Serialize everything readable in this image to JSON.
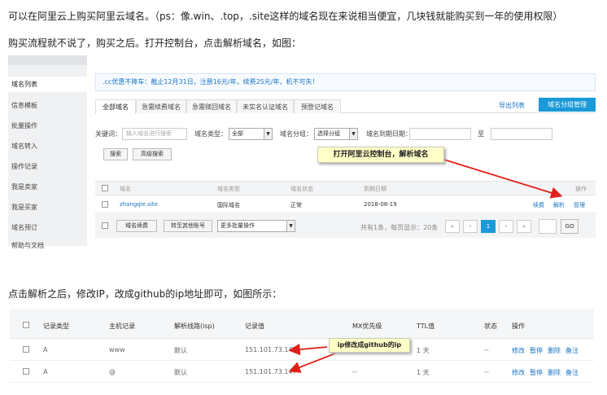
{
  "paragraphs": {
    "intro": "可以在阿里云上购买阿里云域名。（ps：像.win、.top，.site这样的域名现在来说相当便宜，几块钱就能购买到一年的使用权限）",
    "buy": "购买流程就不说了，购买之后。打开控制台，点击解析域名，如图：",
    "after": "点击解析之后，修改IP，改成github的ip地址即可，如图所示："
  },
  "console": {
    "sidebar_items": [
      "域名列表",
      "信息模板",
      "批量操作",
      "域名转入",
      "操作记录",
      "我是卖家",
      "我是买家",
      "域名预订",
      "帮助与文档"
    ],
    "notice": ".cc优惠不降车：截止12月31日，注册16元/年，续费25元/年，机不可失！",
    "tabs": [
      "全部域名",
      "急需续费域名",
      "急需赎回域名",
      "未实名认证域名",
      "预登记域名"
    ],
    "export_label": "导出列表",
    "group_manage_label": "域名分组管理",
    "filters": {
      "keyword_label": "关键词：",
      "keyword_placeholder": "输入域名进行搜索",
      "type_label": "域名类型：",
      "type_value": "全部",
      "group_label": "域名分组：",
      "group_value": "选择分组",
      "expiry_label": "域名到期日期：",
      "to_label": "至",
      "search_button": "搜索",
      "advanced_button": "高级搜索"
    },
    "table_headers": [
      "域名",
      "域名类型",
      "域名状态",
      "到期日期",
      "操作"
    ],
    "row": {
      "domain": "zhangqie.site",
      "type": "国际域名",
      "status": "正常",
      "expiry": "2018-08-19",
      "actions": [
        "续费",
        "解析",
        "管理"
      ]
    },
    "footer": {
      "renew_button": "域名续费",
      "transfer_button": "转至其他账号",
      "batch_value": "更多批量操作",
      "page_info": "共有1条，每页显示：20条",
      "pages": [
        "«",
        "‹",
        "1",
        "›",
        "»"
      ],
      "go_button": "GO"
    },
    "callout": "打开阿里云控制台，解析域名"
  },
  "dns": {
    "headers": [
      "记录类型",
      "主机记录",
      "解析线路(isp)",
      "记录值",
      "MX优先级",
      "TTL值",
      "状态",
      "操作"
    ],
    "rows": [
      {
        "type": "A",
        "host": "www",
        "line": "默认",
        "value": "151.101.73.147",
        "mx": "",
        "ttl": "1 天",
        "status": "--",
        "actions": [
          "修改",
          "暂停",
          "删除",
          "备注"
        ]
      },
      {
        "type": "A",
        "host": "@",
        "line": "默认",
        "value": "151.101.73.147",
        "mx": "--",
        "ttl": "1 天",
        "status": "--",
        "actions": [
          "修改",
          "暂停",
          "删除",
          "备注"
        ]
      }
    ],
    "callout": "ip修改成github的ip"
  },
  "colors": {
    "accent": "#1b9ad8",
    "link": "#1a74c4",
    "arrow": "#e0201a",
    "callout_bg": "#ffffc8"
  }
}
